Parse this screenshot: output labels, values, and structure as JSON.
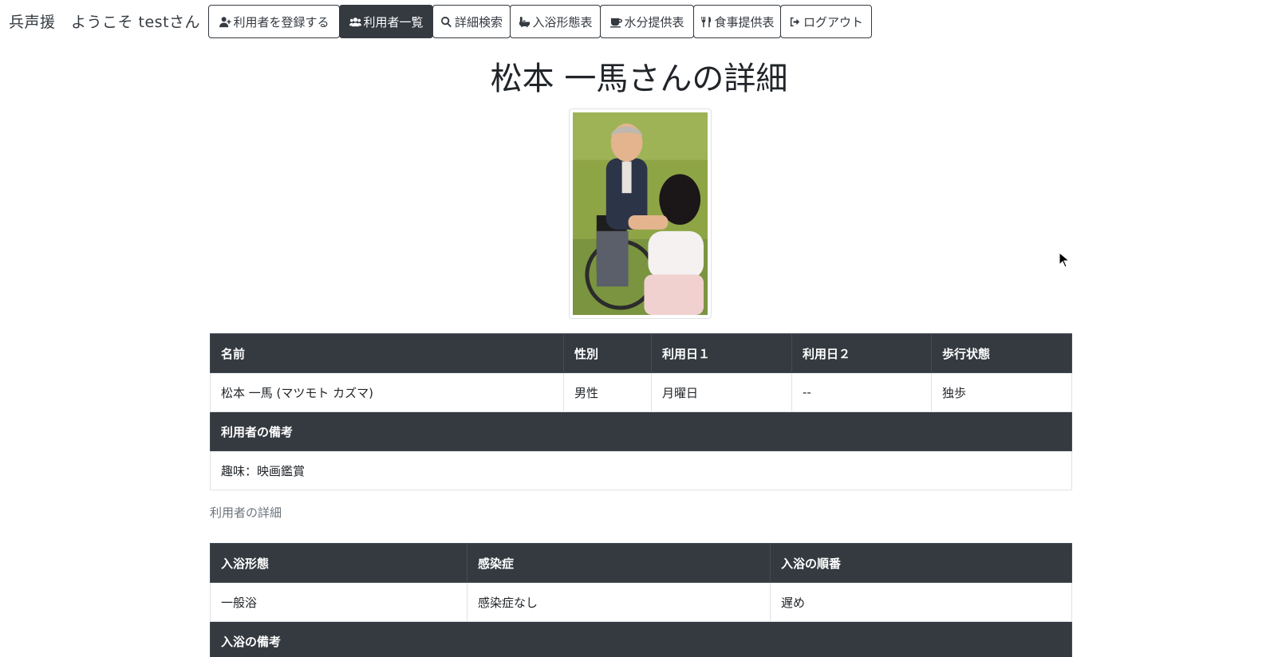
{
  "navbar": {
    "brand": "兵声援　ようこそ testさん",
    "buttons": [
      {
        "label": "利用者を登録する",
        "icon": "user-plus-icon",
        "active": false
      },
      {
        "label": "利用者一覧",
        "icon": "users-icon",
        "active": true
      },
      {
        "label": "詳細検索",
        "icon": "search-icon",
        "active": false
      },
      {
        "label": "入浴形態表",
        "icon": "bath-icon",
        "active": false
      },
      {
        "label": "水分提供表",
        "icon": "cup-icon",
        "active": false
      },
      {
        "label": "食事提供表",
        "icon": "utensils-icon",
        "active": false
      },
      {
        "label": "ログアウト",
        "icon": "logout-icon",
        "active": false
      }
    ]
  },
  "page_title": "松本 一馬さんの詳細",
  "user_table": {
    "headers": [
      "名前",
      "性別",
      "利用日１",
      "利用日２",
      "歩行状態"
    ],
    "row": [
      "松本 一馬 (マツモト カズマ)",
      "男性",
      "月曜日",
      "--",
      "独歩"
    ],
    "notes_header": "利用者の備考",
    "notes": "趣味：映画鑑賞"
  },
  "caption": "利用者の詳細",
  "bath_table": {
    "headers": [
      "入浴形態",
      "感染症",
      "入浴の順番"
    ],
    "row": [
      "一般浴",
      "感染症なし",
      "遅め"
    ],
    "notes_header": "入浴の備考"
  },
  "colors": {
    "dark": "#343a40",
    "muted": "#6c757d",
    "border": "#dee2e6"
  }
}
